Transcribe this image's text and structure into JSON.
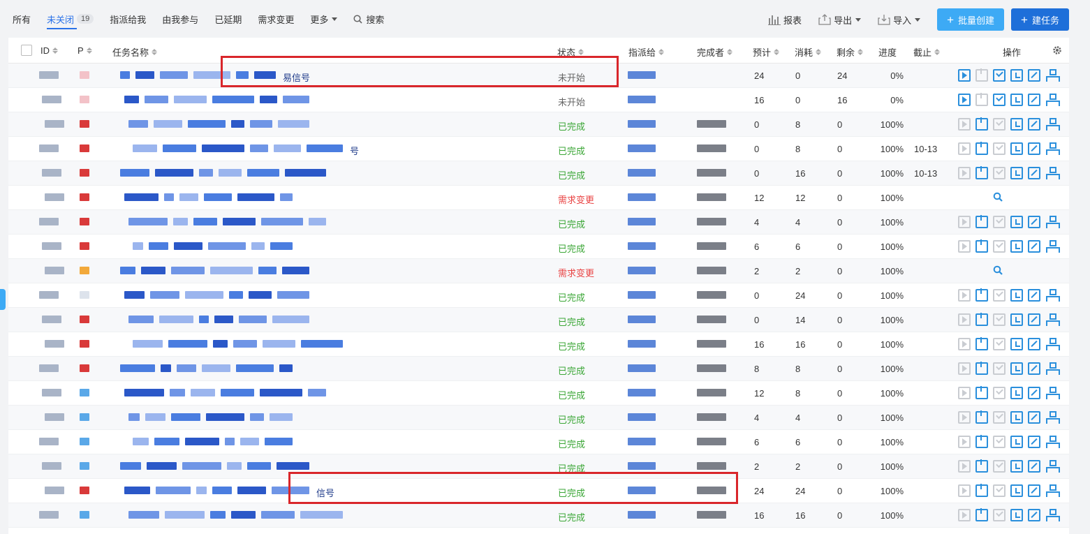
{
  "tabs": [
    {
      "label": "所有"
    },
    {
      "label": "未关闭",
      "count": "19"
    },
    {
      "label": "指派给我"
    },
    {
      "label": "由我参与"
    },
    {
      "label": "已延期"
    },
    {
      "label": "需求变更"
    },
    {
      "label": "更多"
    },
    {
      "label": "搜索"
    }
  ],
  "toolbar": {
    "report": "报表",
    "export": "导出",
    "import": "导入",
    "batch_create": "批量创建",
    "create_task": "建任务"
  },
  "columns": {
    "id": "ID",
    "p": "P",
    "name": "任务名称",
    "status": "状态",
    "assignee": "指派给",
    "finisher": "完成者",
    "estimate": "预计",
    "consumed": "消耗",
    "remain": "剩余",
    "progress": "进度",
    "deadline": "截止",
    "ops": "操作"
  },
  "rows": [
    {
      "name_suffix": "易信号",
      "status": "未开始",
      "estimate": "24",
      "consumed": "0",
      "remain": "24",
      "progress": "0%",
      "deadline": ""
    },
    {
      "name_suffix": "",
      "status": "未开始",
      "estimate": "16",
      "consumed": "0",
      "remain": "16",
      "progress": "0%",
      "deadline": ""
    },
    {
      "name_suffix": "",
      "status": "已完成",
      "estimate": "0",
      "consumed": "8",
      "remain": "0",
      "progress": "100%",
      "deadline": ""
    },
    {
      "name_suffix": "号",
      "status": "已完成",
      "estimate": "0",
      "consumed": "8",
      "remain": "0",
      "progress": "100%",
      "deadline": "10-13"
    },
    {
      "name_suffix": "",
      "status": "已完成",
      "estimate": "0",
      "consumed": "16",
      "remain": "0",
      "progress": "100%",
      "deadline": "10-13"
    },
    {
      "name_suffix": "",
      "status": "需求变更",
      "estimate": "12",
      "consumed": "12",
      "remain": "0",
      "progress": "100%",
      "deadline": ""
    },
    {
      "name_suffix": "",
      "status": "已完成",
      "estimate": "4",
      "consumed": "4",
      "remain": "0",
      "progress": "100%",
      "deadline": ""
    },
    {
      "name_suffix": "",
      "status": "已完成",
      "estimate": "6",
      "consumed": "6",
      "remain": "0",
      "progress": "100%",
      "deadline": ""
    },
    {
      "name_suffix": "",
      "status": "需求变更",
      "estimate": "2",
      "consumed": "2",
      "remain": "0",
      "progress": "100%",
      "deadline": ""
    },
    {
      "name_suffix": "",
      "status": "已完成",
      "estimate": "0",
      "consumed": "24",
      "remain": "0",
      "progress": "100%",
      "deadline": ""
    },
    {
      "name_suffix": "",
      "status": "已完成",
      "estimate": "0",
      "consumed": "14",
      "remain": "0",
      "progress": "100%",
      "deadline": ""
    },
    {
      "name_suffix": "",
      "status": "已完成",
      "estimate": "16",
      "consumed": "16",
      "remain": "0",
      "progress": "100%",
      "deadline": ""
    },
    {
      "name_suffix": "",
      "status": "已完成",
      "estimate": "8",
      "consumed": "8",
      "remain": "0",
      "progress": "100%",
      "deadline": ""
    },
    {
      "name_suffix": "",
      "status": "已完成",
      "estimate": "12",
      "consumed": "8",
      "remain": "0",
      "progress": "100%",
      "deadline": ""
    },
    {
      "name_suffix": "",
      "status": "已完成",
      "estimate": "4",
      "consumed": "4",
      "remain": "0",
      "progress": "100%",
      "deadline": ""
    },
    {
      "name_suffix": "",
      "status": "已完成",
      "estimate": "6",
      "consumed": "6",
      "remain": "0",
      "progress": "100%",
      "deadline": ""
    },
    {
      "name_suffix": "",
      "status": "已完成",
      "estimate": "2",
      "consumed": "2",
      "remain": "0",
      "progress": "100%",
      "deadline": ""
    },
    {
      "name_suffix": "信号",
      "status": "已完成",
      "estimate": "24",
      "consumed": "24",
      "remain": "0",
      "progress": "100%",
      "deadline": ""
    },
    {
      "name_suffix": "",
      "status": "已完成",
      "estimate": "16",
      "consumed": "16",
      "remain": "0",
      "progress": "100%",
      "deadline": ""
    }
  ],
  "colors": {
    "accent": "#2a72e8",
    "done": "#3aa635",
    "change": "#e94444",
    "highlight": "#d9262b"
  }
}
